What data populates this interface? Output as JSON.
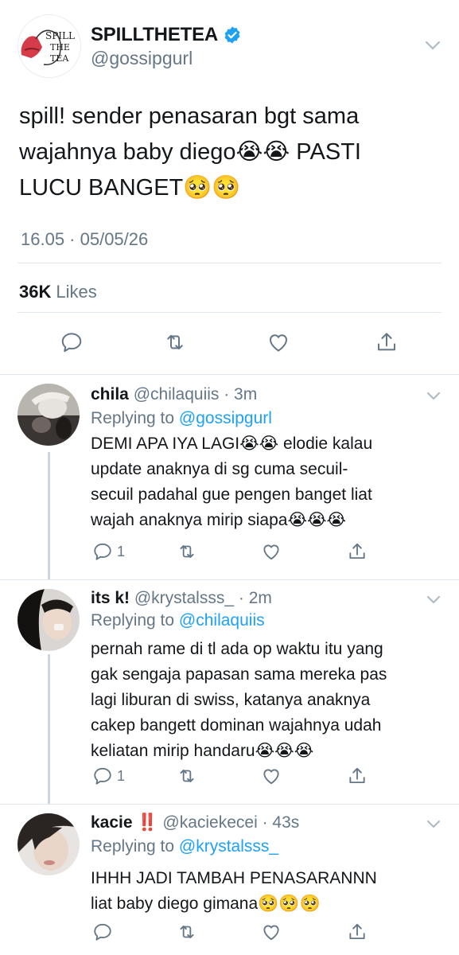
{
  "main_tweet": {
    "author_name": "SPILLTHETEA",
    "author_handle": "@gossipgurl",
    "avatar_text": "SPILL THE TEA",
    "text_line1": "spill! sender penasaran bgt sama",
    "text_line2": "wajahnya baby diego😭😭 PASTI",
    "text_line3": "LUCU BANGET🥺🥺",
    "timestamp": "16.05 · 05/05/26",
    "likes_count": "36K",
    "likes_label": "Likes"
  },
  "replies": [
    {
      "name": "chila",
      "handle_time": "@chilaquiis · 3m",
      "replying_prefix": "Replying to",
      "replying_to": "@gossipgurl",
      "lines": [
        "DEMI APA IYA LAGI😭😭 elodie kalau",
        "update anaknya di sg cuma secuil-",
        "secuil padahal gue pengen banget liat",
        "wajah anaknya mirip siapa😭😭😭"
      ],
      "reply_count": "1"
    },
    {
      "name": "its k!",
      "handle_time": "@krystalsss_ · 2m",
      "replying_prefix": "Replying to",
      "replying_to": "@chilaquiis",
      "lines": [
        "pernah rame di tl ada op waktu itu yang",
        "gak sengaja papasan sama mereka pas",
        "lagi liburan di swiss, katanya anaknya",
        "cakep bangett dominan wajahnya udah",
        "keliatan mirip handaru😭😭😭"
      ],
      "reply_count": "1"
    },
    {
      "name": "kacie ‼️",
      "handle_time": "@kaciekecei · 43s",
      "replying_prefix": "Replying to",
      "replying_to": "@krystalsss_",
      "lines": [
        "IHHH JADI TAMBAH PENASARANNN",
        "liat baby diego gimana🥺🥺🥺"
      ],
      "reply_count": ""
    }
  ],
  "colors": {
    "link": "#1da1f2",
    "secondary_text": "#657786",
    "primary_text": "#14171a",
    "divider": "#e1e8ed",
    "thread_line": "#ccd6dd"
  }
}
